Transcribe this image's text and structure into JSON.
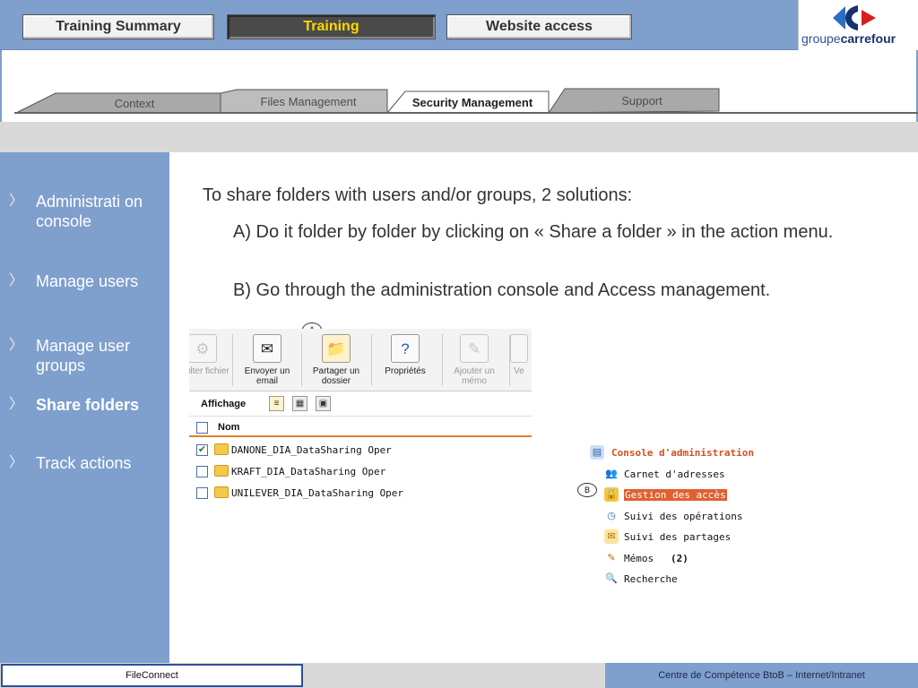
{
  "top_tabs": [
    {
      "label": "Training Summary"
    },
    {
      "label": "Training"
    },
    {
      "label": "Website access"
    }
  ],
  "logo": {
    "text_light": "groupe",
    "text_bold": "carrefour"
  },
  "sub_tabs": [
    {
      "label": "Context"
    },
    {
      "label": "Files Management"
    },
    {
      "label": "Security Management"
    },
    {
      "label": "Support"
    }
  ],
  "sidebar": {
    "items": [
      {
        "label": "Administrati on console"
      },
      {
        "label": "Manage users"
      },
      {
        "label": "Manage user groups"
      },
      {
        "label": "Share folders"
      },
      {
        "label": "Track actions"
      }
    ]
  },
  "content": {
    "intro": "To share folders with users and/or groups, 2 solutions:",
    "option_a": "A) Do it folder by folder by clicking on « Share a folder » in the action menu.",
    "option_b": "B) Go through the administration console and Access management."
  },
  "screenshot_a": {
    "marker": "A",
    "tools": [
      {
        "label": "nsulter fichier",
        "icon": "file-icon"
      },
      {
        "label": "Envoyer un email",
        "icon": "email-icon"
      },
      {
        "label": "Partager un dossier",
        "icon": "share-folder-icon"
      },
      {
        "label": "Propriétés",
        "icon": "properties-icon"
      },
      {
        "label": "Ajouter un mémo",
        "icon": "memo-icon"
      },
      {
        "label": "Ve",
        "icon": "version-icon"
      }
    ],
    "view_label": "Affichage",
    "column_header": "Nom",
    "rows": [
      {
        "name": "DANONE_DIA_DataSharing Oper",
        "checked": true
      },
      {
        "name": "KRAFT_DIA_DataSharing Oper",
        "checked": false
      },
      {
        "name": "UNILEVER_DIA_DataSharing Oper",
        "checked": false
      }
    ]
  },
  "screenshot_b": {
    "marker": "B",
    "title": "Console d'administration",
    "items": [
      {
        "label": "Carnet d'adresses",
        "icon": "address-book-icon"
      },
      {
        "label": "Gestion des accès",
        "icon": "lock-icon",
        "highlighted": true
      },
      {
        "label": "Suivi des opérations",
        "icon": "clock-icon"
      },
      {
        "label": "Suivi des partages",
        "icon": "share-envelope-icon"
      },
      {
        "label": "Mémos",
        "icon": "memo-icon",
        "badge": "(2)"
      },
      {
        "label": "Recherche",
        "icon": "search-icon"
      }
    ]
  },
  "footer": {
    "left": "FileConnect",
    "right": "Centre de Compétence BtoB – Internet/Intranet"
  },
  "colors": {
    "brand_blue": "#7f9fcd",
    "active_tab_bg": "#4a4a4a",
    "active_tab_text": "#ffd700",
    "highlight_orange": "#e06030"
  }
}
